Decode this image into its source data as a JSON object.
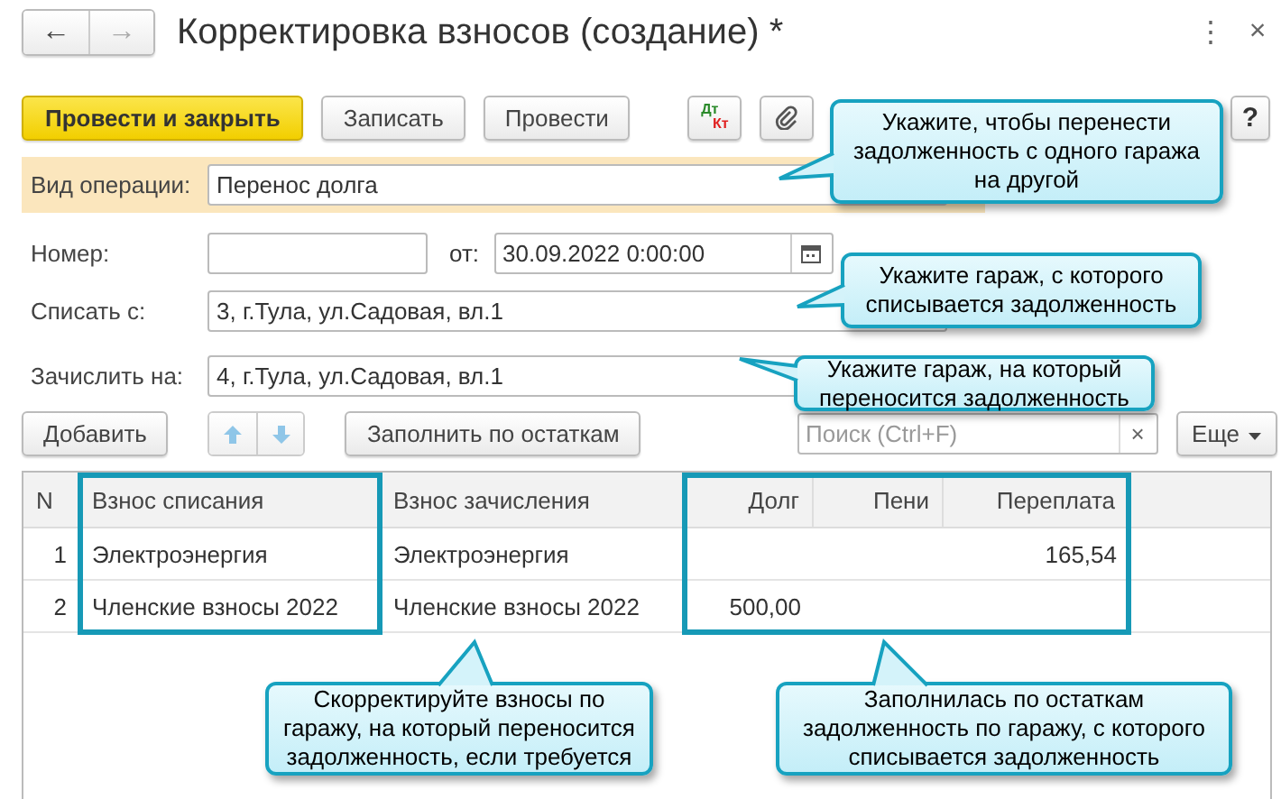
{
  "window": {
    "title": "Корректировка взносов (создание) *",
    "back": "←",
    "forward": "→",
    "menu": "⋮",
    "close": "×"
  },
  "toolbar": [
    {
      "kind": "primary",
      "label": "Провести и закрыть"
    },
    {
      "kind": "default",
      "label": "Записать"
    },
    {
      "kind": "default",
      "label": "Провести"
    },
    {
      "kind": "dtkt",
      "label": "Дт",
      "label2": "Кт"
    },
    {
      "kind": "clip"
    },
    {
      "kind": "help",
      "label": "?"
    }
  ],
  "operation": {
    "label": "Вид операции:",
    "value": "Перенос долга"
  },
  "number": {
    "label": "Номер:",
    "date_label": "от:",
    "date": "30.09.2022  0:00:00"
  },
  "write_off": {
    "label": "Списать с:",
    "value": "3, г.Тула, ул.Садовая, вл.1"
  },
  "credit_to": {
    "label": "Зачислить на:",
    "value": "4, г.Тула, ул.Садовая, вл.1"
  },
  "table_toolbar": {
    "add": "Добавить",
    "fill": "Заполнить по остаткам",
    "search_placeholder": "Поиск (Ctrl+F)",
    "search_clear": "×",
    "more": "Еще"
  },
  "table": {
    "columns": [
      {
        "label": "N",
        "highlighted": false
      },
      {
        "label": "Взнос списания",
        "highlighted": true
      },
      {
        "label": "Взнос зачисления",
        "highlighted": false
      },
      {
        "label": "Долг",
        "highlighted": true
      },
      {
        "label": "Пени",
        "highlighted": true
      },
      {
        "label": "Переплата",
        "highlighted": true
      }
    ],
    "rows": [
      [
        "1",
        "Электроэнергия",
        "Электроэнергия",
        "",
        "",
        "165,54"
      ],
      [
        "2",
        "Членские взносы 2022",
        "Членские взносы 2022",
        "500,00",
        "",
        ""
      ]
    ]
  },
  "callouts": [
    "Укажите, чтобы перенести задолженность с одного гаража на другой",
    "Укажите гараж, с которого списывается задолженность",
    "Укажите гараж, на который переносится задолженность",
    "Скорректируйте взносы по гаражу, на который переносится задолженность, если требуется",
    "Заполнилась по остаткам задолженность по гаражу, с которого списывается задолженность"
  ]
}
